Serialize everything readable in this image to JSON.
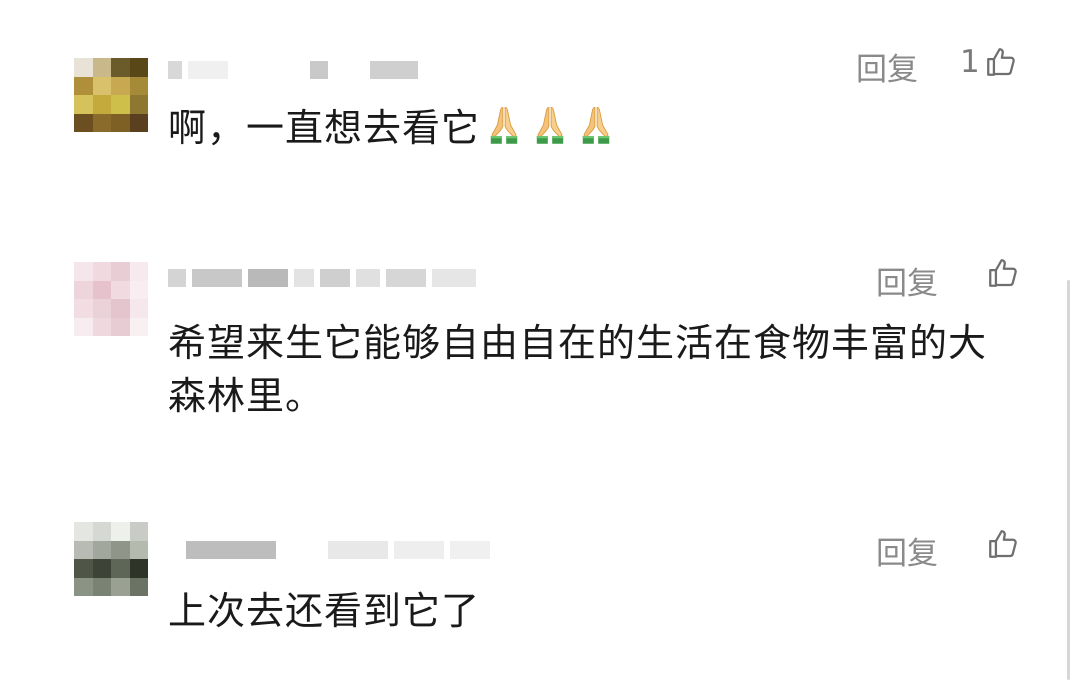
{
  "comments": [
    {
      "text": "啊，一直想去看它",
      "reply_label": "回复",
      "like_count": "1",
      "emoji_count": 3,
      "avatar_colors": [
        "#e8e3d6",
        "#c9b98a",
        "#6b5a2a",
        "#5a4718",
        "#b08f3a",
        "#d9c06a",
        "#c8a952",
        "#a58a38",
        "#d6c25b",
        "#c4a93c",
        "#cdbf4a",
        "#8e7730",
        "#6c4f20",
        "#8b6b2c",
        "#7e5f24",
        "#5b4020"
      ]
    },
    {
      "text": "希望来生它能够自由自在的生活在食物丰富的大森林里。",
      "reply_label": "回复",
      "like_count": "",
      "avatar_colors": [
        "#f4e6ea",
        "#f0d9df",
        "#e9cdd4",
        "#f6eaee",
        "#eed4db",
        "#e6c3cc",
        "#f1dbe1",
        "#f8eef1",
        "#f2dde3",
        "#ebd1d8",
        "#e4c5ce",
        "#f5e7eb",
        "#f7ecef",
        "#efd8de",
        "#e8ccd3",
        "#f9f0f2"
      ]
    },
    {
      "text": "上次去还看到它了",
      "reply_label": "回复",
      "like_count": "",
      "avatar_colors": [
        "#e4e6e2",
        "#d6d8d3",
        "#eef0ec",
        "#c9ccc6",
        "#b7bbb3",
        "#a2a79d",
        "#8f9689",
        "#b5baae",
        "#4f5648",
        "#3d4336",
        "#5e6658",
        "#2f3429",
        "#8b9384",
        "#7a8273",
        "#9aa192",
        "#6b7364"
      ]
    }
  ]
}
